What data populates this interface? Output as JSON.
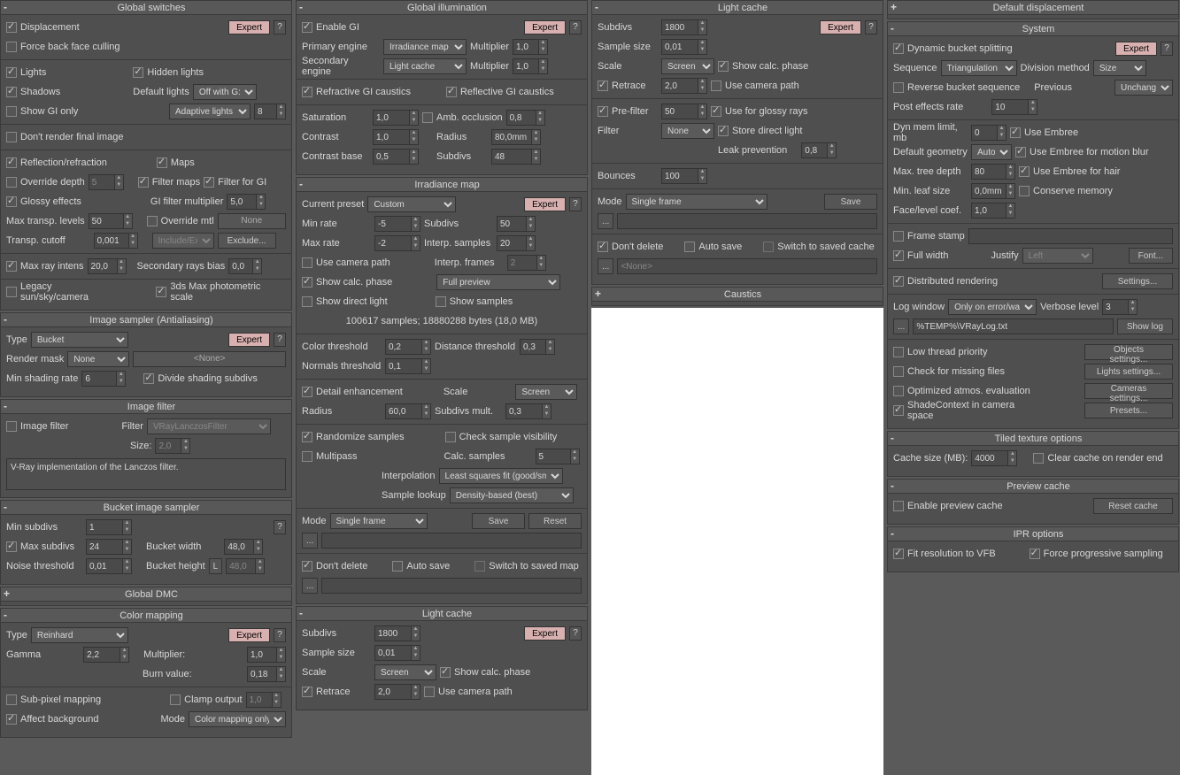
{
  "expert": "Expert",
  "help": "?",
  "none_label": "<None>",
  "globalSwitches": {
    "title": "Global switches",
    "displacement": "Displacement",
    "forceBackFace": "Force back face culling",
    "lights": "Lights",
    "hiddenLights": "Hidden lights",
    "shadows": "Shadows",
    "defaultLights": "Default lights",
    "defaultLightsVal": "Off with G:",
    "showGIOnly": "Show GI only",
    "adaptiveLights": "Adaptive lights",
    "adaptiveVal": "8",
    "dontRender": "Don't render final image",
    "reflRefr": "Reflection/refraction",
    "maps": "Maps",
    "overrideDepth": "Override depth",
    "overrideDepthVal": "5",
    "filterMaps": "Filter maps",
    "filterForGI": "Filter for GI",
    "glossy": "Glossy effects",
    "giFilterMult": "GI filter multiplier",
    "giFilterMultVal": "5,0",
    "maxTransp": "Max transp. levels",
    "maxTranspVal": "50",
    "overrideMtl": "Override mtl",
    "noneBtn": "None",
    "transpCutoff": "Transp. cutoff",
    "transpCutoffVal": "0,001",
    "includeExc": "Include/Exc",
    "exclude": "Exclude...",
    "maxRayIntens": "Max ray intens",
    "maxRayVal": "20,0",
    "secondaryBias": "Secondary rays bias",
    "secondaryBiasVal": "0,0",
    "legacy": "Legacy sun/sky/camera",
    "photometric": "3ds Max photometric scale"
  },
  "imageSampler": {
    "title": "Image sampler (Antialiasing)",
    "type": "Type",
    "typeVal": "Bucket",
    "renderMask": "Render mask",
    "renderMaskVal": "None",
    "minShading": "Min shading rate",
    "minShadingVal": "6",
    "divideSubdivs": "Divide shading subdivs"
  },
  "imageFilter": {
    "title": "Image filter",
    "imageFilter": "Image filter",
    "filter": "Filter",
    "filterVal": "VRayLanczosFilter",
    "size": "Size:",
    "sizeVal": "2,0",
    "desc": "V-Ray implementation of the Lanczos filter."
  },
  "bucketSampler": {
    "title": "Bucket image sampler",
    "minSubdivs": "Min subdivs",
    "minSubdivsVal": "1",
    "maxSubdivs": "Max subdivs",
    "maxSubdivsVal": "24",
    "bucketWidth": "Bucket width",
    "bucketWidthVal": "48,0",
    "noiseThresh": "Noise threshold",
    "noiseThreshVal": "0,01",
    "bucketHeight": "Bucket height",
    "bucketHeightLock": "L",
    "bucketHeightVal": "48,0"
  },
  "globalDMC": {
    "title": "Global DMC"
  },
  "colorMapping": {
    "title": "Color mapping",
    "type": "Type",
    "typeVal": "Reinhard",
    "gamma": "Gamma",
    "gammaVal": "2,2",
    "multiplier": "Multiplier:",
    "multiplierVal": "1,0",
    "burn": "Burn value:",
    "burnVal": "0,18",
    "subPixel": "Sub-pixel mapping",
    "clamp": "Clamp output",
    "clampVal": "1,0",
    "affectBg": "Affect background",
    "mode": "Mode",
    "modeVal": "Color mapping only"
  },
  "gi": {
    "title": "Global illumination",
    "enable": "Enable GI",
    "primary": "Primary engine",
    "primaryVal": "Irradiance map",
    "secondary": "Secondary engine",
    "secondaryVal": "Light cache",
    "multiplier": "Multiplier",
    "multVal": "1,0",
    "refractive": "Refractive GI caustics",
    "reflective": "Reflective GI caustics",
    "saturation": "Saturation",
    "satVal": "1,0",
    "contrast": "Contrast",
    "contVal": "1,0",
    "contrastBase": "Contrast base",
    "contBaseVal": "0,5",
    "ambOcc": "Amb. occlusion",
    "ambOccVal": "0,8",
    "radius": "Radius",
    "radiusVal": "80,0mm",
    "subdivs": "Subdivs",
    "subdivsVal": "48"
  },
  "irradiance": {
    "title": "Irradiance map",
    "currentPreset": "Current preset",
    "presetVal": "Custom",
    "minRate": "Min rate",
    "minRateVal": "-5",
    "maxRate": "Max rate",
    "maxRateVal": "-2",
    "subdivs": "Subdivs",
    "subdivsVal": "50",
    "interpSamples": "Interp. samples",
    "interpSamplesVal": "20",
    "interpFrames": "Interp. frames",
    "interpFramesVal": "2",
    "useCamera": "Use camera path",
    "showCalc": "Show calc. phase",
    "fullPreview": "Full preview",
    "showDirect": "Show direct light",
    "showSamples": "Show samples",
    "stats": "100617 samples; 18880288 bytes (18,0 MB)",
    "colorThresh": "Color threshold",
    "colorThreshVal": "0,2",
    "normalsThresh": "Normals threshold",
    "normalsThreshVal": "0,1",
    "distThresh": "Distance threshold",
    "distThreshVal": "0,3",
    "detailEnh": "Detail enhancement",
    "scale": "Scale",
    "scaleVal": "Screen",
    "detailRadius": "Radius",
    "detailRadiusVal": "60,0",
    "subdivsMult": "Subdivs mult.",
    "subdivsMultVal": "0,3",
    "randomize": "Randomize samples",
    "multipass": "Multipass",
    "checkVis": "Check sample visibility",
    "calcSamples": "Calc. samples",
    "calcSamplesVal": "5",
    "interpolation": "Interpolation",
    "interpolationVal": "Least squares fit (good/sm",
    "sampleLookup": "Sample lookup",
    "sampleLookupVal": "Density-based (best)",
    "mode": "Mode",
    "modeVal": "Single frame",
    "save": "Save",
    "reset": "Reset",
    "dotdotdot": "...",
    "dontDelete": "Don't delete",
    "autoSave": "Auto save",
    "switchSaved": "Switch to saved map"
  },
  "lightCache": {
    "title": "Light cache",
    "subdivs": "Subdivs",
    "subdivsVal": "1800",
    "sampleSize": "Sample size",
    "sampleSizeVal": "0,01",
    "scale": "Scale",
    "scaleVal": "Screen",
    "showCalc": "Show calc. phase",
    "retrace": "Retrace",
    "retraceVal": "2,0",
    "useCamera": "Use camera path",
    "preFilter": "Pre-filter",
    "preFilterVal": "50",
    "useGlossy": "Use for glossy rays",
    "filter": "Filter",
    "filterVal": "None",
    "storeDirect": "Store direct light",
    "leakPrev": "Leak prevention",
    "leakPrevVal": "0,8",
    "bounces": "Bounces",
    "bouncesVal": "100",
    "mode": "Mode",
    "modeVal": "Single frame",
    "save": "Save",
    "dontDelete": "Don't delete",
    "autoSave": "Auto save",
    "switchSaved": "Switch to saved cache"
  },
  "caustics": {
    "title": "Caustics"
  },
  "defaultDisp": {
    "title": "Default displacement"
  },
  "system": {
    "title": "System",
    "dynBucket": "Dynamic bucket splitting",
    "sequence": "Sequence",
    "sequenceVal": "Triangulation",
    "divMethod": "Division method",
    "divMethodVal": "Size",
    "reverseBucket": "Reverse bucket sequence",
    "previous": "Previous",
    "previousVal": "Unchange",
    "postEffects": "Post effects rate",
    "postEffectsVal": "10",
    "dynMem": "Dyn mem limit, mb",
    "dynMemVal": "0",
    "useEmbree": "Use Embree",
    "defaultGeom": "Default geometry",
    "defaultGeomVal": "Auto",
    "embreeMotion": "Use Embree for motion blur",
    "maxTreeDepth": "Max. tree depth",
    "maxTreeDepthVal": "80",
    "embreeHair": "Use Embree for hair",
    "minLeaf": "Min. leaf size",
    "minLeafVal": "0,0mm",
    "conserveMemory": "Conserve memory",
    "faceLevel": "Face/level coef.",
    "faceLevelVal": "1,0",
    "frameStamp": "Frame stamp",
    "fullWidth": "Full width",
    "justify": "Justify",
    "justifyVal": "Left",
    "font": "Font...",
    "distributed": "Distributed rendering",
    "settings": "Settings...",
    "logWindow": "Log window",
    "logWindowVal": "Only on error/war",
    "verbose": "Verbose level",
    "verboseVal": "3",
    "logPath": "%TEMP%\\VRayLog.txt",
    "showLog": "Show log",
    "lowThread": "Low thread priority",
    "objectsSettings": "Objects settings...",
    "checkMissing": "Check for missing files",
    "lightsSettings": "Lights settings...",
    "optimizedAtmos": "Optimized atmos. evaluation",
    "camerasSettings": "Cameras settings...",
    "shadeContext": "ShadeContext in camera space",
    "presets": "Presets..."
  },
  "tiledTex": {
    "title": "Tiled texture options",
    "cacheSize": "Cache size (MB):",
    "cacheSizeVal": "4000",
    "clearCache": "Clear cache on render end"
  },
  "previewCache": {
    "title": "Preview cache",
    "enable": "Enable preview cache",
    "reset": "Reset cache"
  },
  "ipr": {
    "title": "IPR options",
    "fitRes": "Fit resolution to VFB",
    "forceProg": "Force progressive sampling"
  }
}
